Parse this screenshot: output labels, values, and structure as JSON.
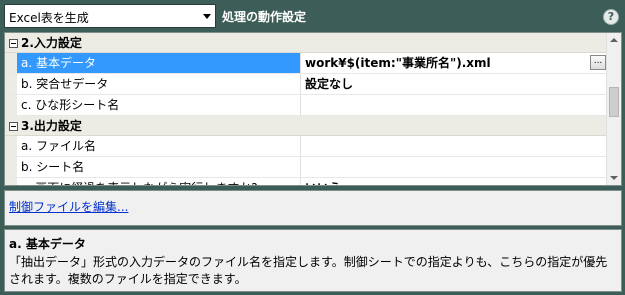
{
  "toolbar": {
    "select_value": "Excel表を生成",
    "title": "処理の動作設定",
    "help_glyph": "?"
  },
  "grid": {
    "categories": [
      {
        "label": "2.入力設定",
        "props": [
          {
            "name": "a. 基本データ",
            "value": "work¥$(item:\"事業所名\").xml",
            "selected": true
          },
          {
            "name": "b. 突合せデータ",
            "value": "設定なし"
          },
          {
            "name": "c. ひな形シート名",
            "value": ""
          }
        ]
      },
      {
        "label": "3.出力設定",
        "props": [
          {
            "name": "a. ファイル名",
            "value": ""
          },
          {
            "name": "b. シート名",
            "value": ""
          },
          {
            "name": "c. 画面に経過を表示しながら実行しますか?",
            "value": "いいえ"
          }
        ]
      }
    ],
    "ellipsis_label": "..."
  },
  "link": {
    "label": "制御ファイルを編集..."
  },
  "description": {
    "title": "a. 基本データ",
    "text": "「抽出データ」形式の入力データのファイル名を指定します。制御シートでの指定よりも、こちらの指定が優先されます。複数のファイルを指定できます。"
  },
  "colors": {
    "header_bg": "#3d5d58",
    "selection": "#3399ff",
    "category_bg": "#ecebe4"
  }
}
